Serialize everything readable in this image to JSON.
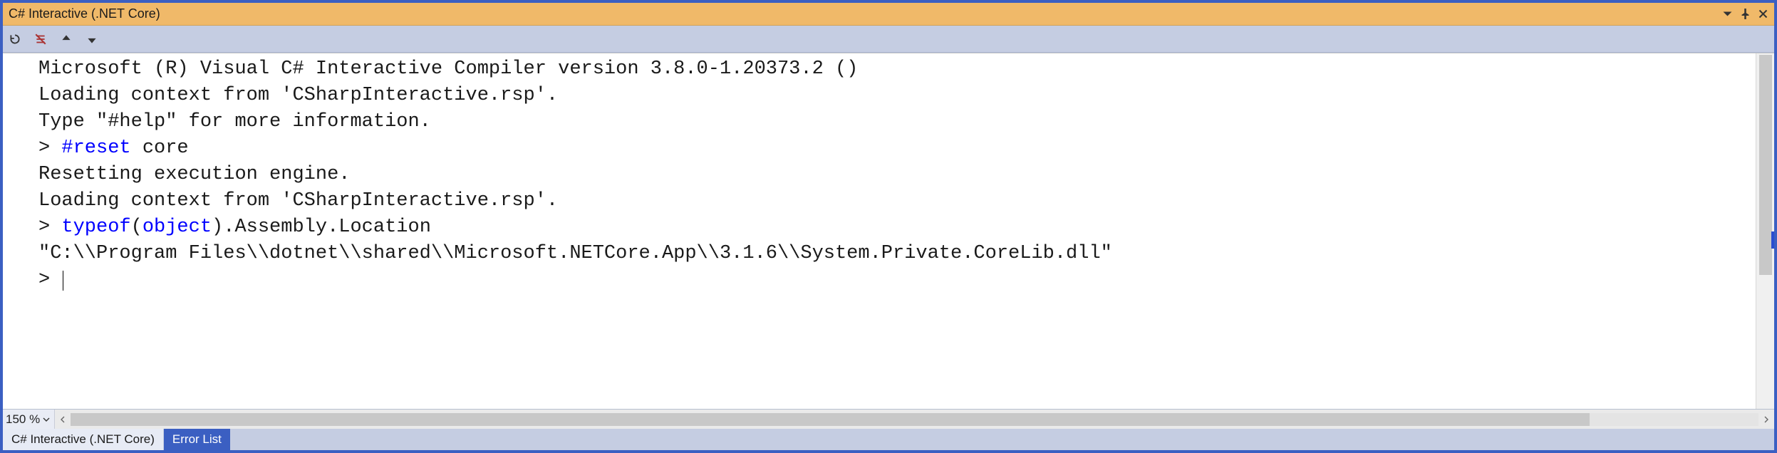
{
  "title": "C# Interactive (.NET Core)",
  "toolbar": {
    "icons": {
      "reset": "reset-icon",
      "clear": "clear-icon",
      "history_up": "arrow-up-icon",
      "history_down": "arrow-down-icon"
    }
  },
  "window_controls": {
    "dropdown": "▾",
    "pin": "pin",
    "close": "×"
  },
  "console": {
    "lines": [
      {
        "type": "text",
        "text": "Microsoft (R) Visual C# Interactive Compiler version 3.8.0-1.20373.2 ()"
      },
      {
        "type": "text",
        "text": "Loading context from 'CSharpInteractive.rsp'."
      },
      {
        "type": "text",
        "text": "Type \"#help\" for more information."
      },
      {
        "type": "input",
        "prompt": "> ",
        "segments": [
          {
            "text": "#reset",
            "style": "directive"
          },
          {
            "text": " core",
            "style": "plain"
          }
        ]
      },
      {
        "type": "text",
        "text": "Resetting execution engine."
      },
      {
        "type": "text",
        "text": "Loading context from 'CSharpInteractive.rsp'."
      },
      {
        "type": "input",
        "prompt": "> ",
        "segments": [
          {
            "text": "typeof",
            "style": "keyword"
          },
          {
            "text": "(",
            "style": "plain"
          },
          {
            "text": "object",
            "style": "keyword"
          },
          {
            "text": ").Assembly.Location",
            "style": "plain"
          }
        ]
      },
      {
        "type": "text",
        "text": "\"C:\\\\Program Files\\\\dotnet\\\\shared\\\\Microsoft.NETCore.App\\\\3.1.6\\\\System.Private.CoreLib.dll\""
      },
      {
        "type": "prompt",
        "prompt": "> ",
        "caret": true
      }
    ]
  },
  "zoom": {
    "label": "150 %"
  },
  "tabs": [
    {
      "label": "C# Interactive (.NET Core)",
      "active": false
    },
    {
      "label": "Error List",
      "active": true
    }
  ],
  "colors": {
    "accent_orange": "#f0b969",
    "accent_blue": "#3b5fc2",
    "panel_blue": "#c5cde2",
    "keyword": "#0000ff"
  }
}
